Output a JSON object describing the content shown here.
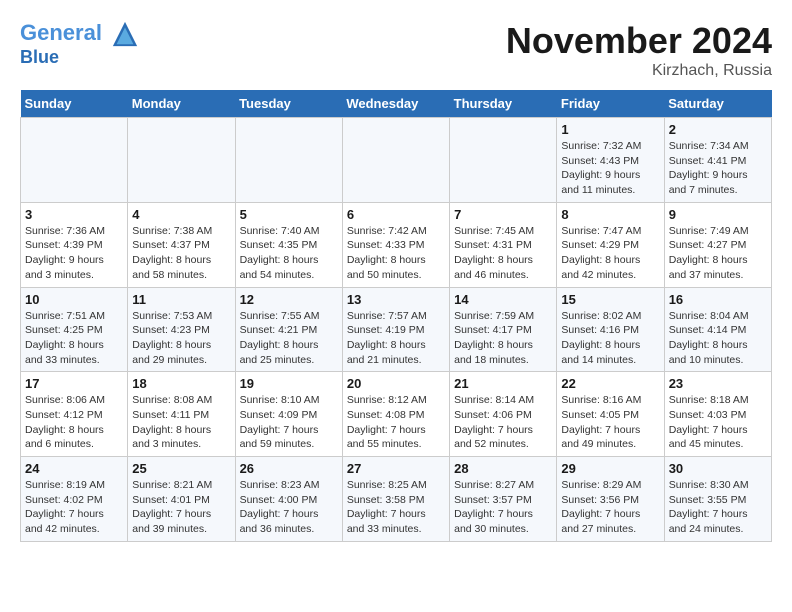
{
  "header": {
    "logo_line1": "General",
    "logo_line2": "Blue",
    "month": "November 2024",
    "location": "Kirzhach, Russia"
  },
  "weekdays": [
    "Sunday",
    "Monday",
    "Tuesday",
    "Wednesday",
    "Thursday",
    "Friday",
    "Saturday"
  ],
  "weeks": [
    [
      {
        "day": "",
        "info": ""
      },
      {
        "day": "",
        "info": ""
      },
      {
        "day": "",
        "info": ""
      },
      {
        "day": "",
        "info": ""
      },
      {
        "day": "",
        "info": ""
      },
      {
        "day": "1",
        "info": "Sunrise: 7:32 AM\nSunset: 4:43 PM\nDaylight: 9 hours and 11 minutes."
      },
      {
        "day": "2",
        "info": "Sunrise: 7:34 AM\nSunset: 4:41 PM\nDaylight: 9 hours and 7 minutes."
      }
    ],
    [
      {
        "day": "3",
        "info": "Sunrise: 7:36 AM\nSunset: 4:39 PM\nDaylight: 9 hours and 3 minutes."
      },
      {
        "day": "4",
        "info": "Sunrise: 7:38 AM\nSunset: 4:37 PM\nDaylight: 8 hours and 58 minutes."
      },
      {
        "day": "5",
        "info": "Sunrise: 7:40 AM\nSunset: 4:35 PM\nDaylight: 8 hours and 54 minutes."
      },
      {
        "day": "6",
        "info": "Sunrise: 7:42 AM\nSunset: 4:33 PM\nDaylight: 8 hours and 50 minutes."
      },
      {
        "day": "7",
        "info": "Sunrise: 7:45 AM\nSunset: 4:31 PM\nDaylight: 8 hours and 46 minutes."
      },
      {
        "day": "8",
        "info": "Sunrise: 7:47 AM\nSunset: 4:29 PM\nDaylight: 8 hours and 42 minutes."
      },
      {
        "day": "9",
        "info": "Sunrise: 7:49 AM\nSunset: 4:27 PM\nDaylight: 8 hours and 37 minutes."
      }
    ],
    [
      {
        "day": "10",
        "info": "Sunrise: 7:51 AM\nSunset: 4:25 PM\nDaylight: 8 hours and 33 minutes."
      },
      {
        "day": "11",
        "info": "Sunrise: 7:53 AM\nSunset: 4:23 PM\nDaylight: 8 hours and 29 minutes."
      },
      {
        "day": "12",
        "info": "Sunrise: 7:55 AM\nSunset: 4:21 PM\nDaylight: 8 hours and 25 minutes."
      },
      {
        "day": "13",
        "info": "Sunrise: 7:57 AM\nSunset: 4:19 PM\nDaylight: 8 hours and 21 minutes."
      },
      {
        "day": "14",
        "info": "Sunrise: 7:59 AM\nSunset: 4:17 PM\nDaylight: 8 hours and 18 minutes."
      },
      {
        "day": "15",
        "info": "Sunrise: 8:02 AM\nSunset: 4:16 PM\nDaylight: 8 hours and 14 minutes."
      },
      {
        "day": "16",
        "info": "Sunrise: 8:04 AM\nSunset: 4:14 PM\nDaylight: 8 hours and 10 minutes."
      }
    ],
    [
      {
        "day": "17",
        "info": "Sunrise: 8:06 AM\nSunset: 4:12 PM\nDaylight: 8 hours and 6 minutes."
      },
      {
        "day": "18",
        "info": "Sunrise: 8:08 AM\nSunset: 4:11 PM\nDaylight: 8 hours and 3 minutes."
      },
      {
        "day": "19",
        "info": "Sunrise: 8:10 AM\nSunset: 4:09 PM\nDaylight: 7 hours and 59 minutes."
      },
      {
        "day": "20",
        "info": "Sunrise: 8:12 AM\nSunset: 4:08 PM\nDaylight: 7 hours and 55 minutes."
      },
      {
        "day": "21",
        "info": "Sunrise: 8:14 AM\nSunset: 4:06 PM\nDaylight: 7 hours and 52 minutes."
      },
      {
        "day": "22",
        "info": "Sunrise: 8:16 AM\nSunset: 4:05 PM\nDaylight: 7 hours and 49 minutes."
      },
      {
        "day": "23",
        "info": "Sunrise: 8:18 AM\nSunset: 4:03 PM\nDaylight: 7 hours and 45 minutes."
      }
    ],
    [
      {
        "day": "24",
        "info": "Sunrise: 8:19 AM\nSunset: 4:02 PM\nDaylight: 7 hours and 42 minutes."
      },
      {
        "day": "25",
        "info": "Sunrise: 8:21 AM\nSunset: 4:01 PM\nDaylight: 7 hours and 39 minutes."
      },
      {
        "day": "26",
        "info": "Sunrise: 8:23 AM\nSunset: 4:00 PM\nDaylight: 7 hours and 36 minutes."
      },
      {
        "day": "27",
        "info": "Sunrise: 8:25 AM\nSunset: 3:58 PM\nDaylight: 7 hours and 33 minutes."
      },
      {
        "day": "28",
        "info": "Sunrise: 8:27 AM\nSunset: 3:57 PM\nDaylight: 7 hours and 30 minutes."
      },
      {
        "day": "29",
        "info": "Sunrise: 8:29 AM\nSunset: 3:56 PM\nDaylight: 7 hours and 27 minutes."
      },
      {
        "day": "30",
        "info": "Sunrise: 8:30 AM\nSunset: 3:55 PM\nDaylight: 7 hours and 24 minutes."
      }
    ]
  ]
}
